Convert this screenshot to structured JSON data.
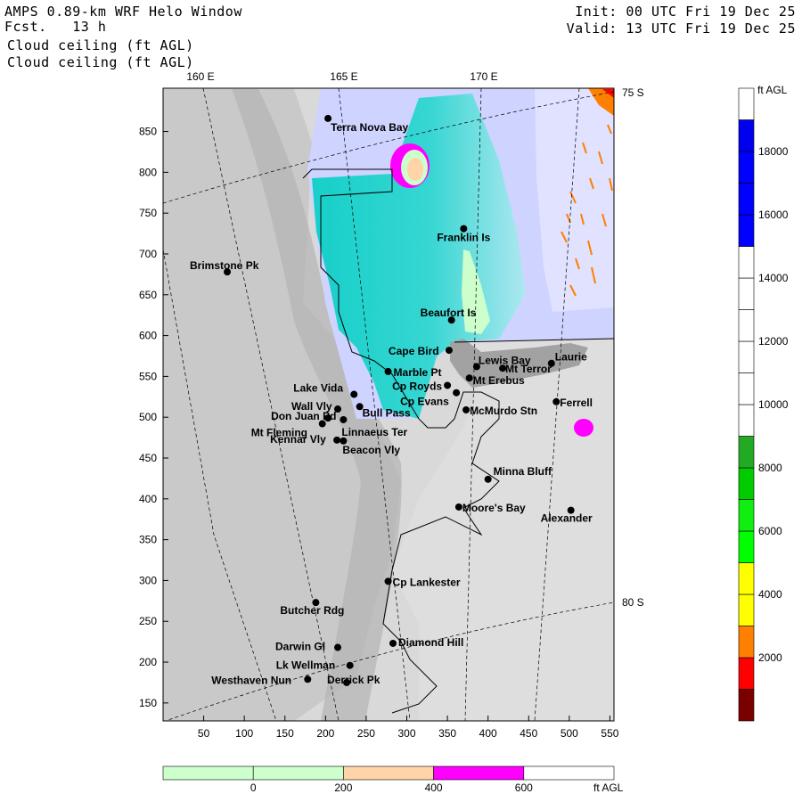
{
  "header": {
    "title": "AMPS 0.89-km WRF Helo Window",
    "fcst": "Fcst.   13 h",
    "field_1": "Cloud ceiling (ft AGL)",
    "field_2": "Cloud ceiling (ft AGL)",
    "init": "Init: 00 UTC Fri 19 Dec 25",
    "valid": "Valid: 13 UTC Fri 19 Dec 25"
  },
  "map": {
    "lon_labels": [
      "160 E",
      "165 E",
      "170 E"
    ],
    "lat_labels": [
      "75 S",
      "80 S"
    ],
    "x_ticks": [
      50,
      100,
      150,
      200,
      250,
      300,
      350,
      400,
      450,
      500,
      550
    ],
    "y_ticks": [
      150,
      200,
      250,
      300,
      350,
      400,
      450,
      500,
      550,
      600,
      650,
      700,
      750,
      800,
      850
    ],
    "x_range": [
      0,
      555
    ],
    "y_range": [
      128,
      903
    ],
    "colors": {
      "ice": "#d7d7d7",
      "ice_dark": "#a8a8a8",
      "sea": "#17cfc9",
      "sea_light": "#c8ccff",
      "frame": "#000000"
    },
    "places": [
      {
        "name": "Terra Nova Bay",
        "x": 203,
        "y": 866
      },
      {
        "name": "Franklin Is",
        "x": 370,
        "y": 731
      },
      {
        "name": "Brimstone Pk",
        "x": 79,
        "y": 678
      },
      {
        "name": "Beaufort Is",
        "x": 355,
        "y": 619
      },
      {
        "name": "Cape Bird",
        "x": 352,
        "y": 582
      },
      {
        "name": "Lewis Bay",
        "x": 386,
        "y": 562
      },
      {
        "name": "Laurie",
        "x": 478,
        "y": 566
      },
      {
        "name": "Marble Pt",
        "x": 277,
        "y": 556
      },
      {
        "name": "Mt Terror",
        "x": 418,
        "y": 560
      },
      {
        "name": "Cp Royds",
        "x": 350,
        "y": 539
      },
      {
        "name": "Mt Erebus",
        "x": 377,
        "y": 548
      },
      {
        "name": "Lake Vida",
        "x": 235,
        "y": 528
      },
      {
        "name": "Cp Evans",
        "x": 361,
        "y": 530
      },
      {
        "name": "Ferrell",
        "x": 484,
        "y": 519
      },
      {
        "name": "Wall Vly",
        "x": 215,
        "y": 510
      },
      {
        "name": "Bull Pass",
        "x": 242,
        "y": 513
      },
      {
        "name": "McMurdo Stn",
        "x": 373,
        "y": 509
      },
      {
        "name": "Don Juan Pd",
        "x": 203,
        "y": 499
      },
      {
        "name": "Mt Fleming",
        "x": 196,
        "y": 492
      },
      {
        "name": "Linnaeus Ter",
        "x": 222,
        "y": 497
      },
      {
        "name": "Kennar Vly",
        "x": 214,
        "y": 472
      },
      {
        "name": "Beacon Vly",
        "x": 222,
        "y": 471
      },
      {
        "name": "Minna Bluff",
        "x": 400,
        "y": 424
      },
      {
        "name": "Moore's Bay",
        "x": 364,
        "y": 390
      },
      {
        "name": "Alexander",
        "x": 502,
        "y": 386
      },
      {
        "name": "Cp Lankester",
        "x": 277,
        "y": 299
      },
      {
        "name": "Butcher Rdg",
        "x": 188,
        "y": 273
      },
      {
        "name": "Diamond Hill",
        "x": 283,
        "y": 223
      },
      {
        "name": "Darwin Gl",
        "x": 215,
        "y": 218
      },
      {
        "name": "Lk Wellman",
        "x": 230,
        "y": 196
      },
      {
        "name": "Westhaven Nun",
        "x": 178,
        "y": 179
      },
      {
        "name": "Derrick Pk",
        "x": 226,
        "y": 175
      }
    ]
  },
  "colorbar_right": {
    "unit": "ft AGL",
    "labels": [
      "2000",
      "4000",
      "6000",
      "8000",
      "10000",
      "12000",
      "14000",
      "16000",
      "18000"
    ],
    "bands": [
      "#7a0000",
      "#ff0000",
      "#ff7f00",
      "#ffff00",
      "#ffff00",
      "#00ff00",
      "#11ee11",
      "#00cc00",
      "#22aa22",
      "#ffffff",
      "#ffffff",
      "#ffffff",
      "#ffffff",
      "#ffffff",
      "#ffffff",
      "#0000ff",
      "#0000ff",
      "#0000ff",
      "#0000ee",
      "#ffffff"
    ]
  },
  "colorbar_bottom": {
    "unit": "ft AGL",
    "labels": [
      "0",
      "200",
      "400",
      "600"
    ],
    "bands": [
      "#ccffcc",
      "#ccffcc",
      "#ffd4a8",
      "#ff00ff",
      "#ffffff"
    ]
  }
}
